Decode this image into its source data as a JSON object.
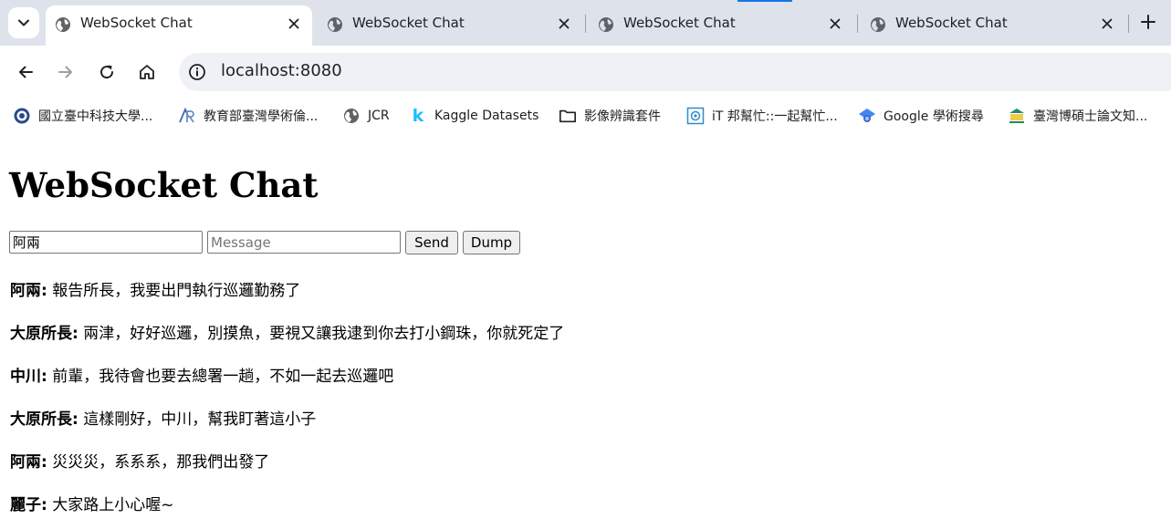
{
  "tabs": [
    {
      "title": "WebSocket Chat",
      "active": true
    },
    {
      "title": "WebSocket Chat",
      "active": false
    },
    {
      "title": "WebSocket Chat",
      "active": false
    },
    {
      "title": "WebSocket Chat",
      "active": false
    }
  ],
  "omnibox": {
    "url": "localhost:8080"
  },
  "bookmarks": [
    {
      "label": "國立臺中科技大學...",
      "icon": "school-seal-icon"
    },
    {
      "label": "教育部臺灣學術倫...",
      "icon": "ar-logo-icon"
    },
    {
      "label": "JCR",
      "icon": "globe-icon"
    },
    {
      "label": "Kaggle Datasets",
      "icon": "kaggle-icon"
    },
    {
      "label": "影像辨識套件",
      "icon": "folder-icon"
    },
    {
      "label": "iT 邦幫忙::一起幫忙...",
      "icon": "ithome-icon"
    },
    {
      "label": "Google 學術搜尋",
      "icon": "scholar-icon"
    },
    {
      "label": "臺灣博碩士論文知...",
      "icon": "ndltd-icon"
    }
  ],
  "page": {
    "heading": "WebSocket Chat",
    "name_value": "阿兩",
    "message_placeholder": "Message",
    "send_label": "Send",
    "dump_label": "Dump"
  },
  "messages": [
    {
      "sender": "阿兩:",
      "text": " 報告所長，我要出門執行巡邏勤務了"
    },
    {
      "sender": "大原所長:",
      "text": " 兩津，好好巡邏，別摸魚，要視又讓我逮到你去打小鋼珠，你就死定了"
    },
    {
      "sender": "中川:",
      "text": " 前輩，我待會也要去總署一趟，不如一起去巡邏吧"
    },
    {
      "sender": "大原所長:",
      "text": " 這樣剛好，中川，幫我盯著這小子"
    },
    {
      "sender": "阿兩:",
      "text": " 災災災，系系系，那我們出發了"
    },
    {
      "sender": "麗子:",
      "text": " 大家路上小心喔~"
    }
  ]
}
